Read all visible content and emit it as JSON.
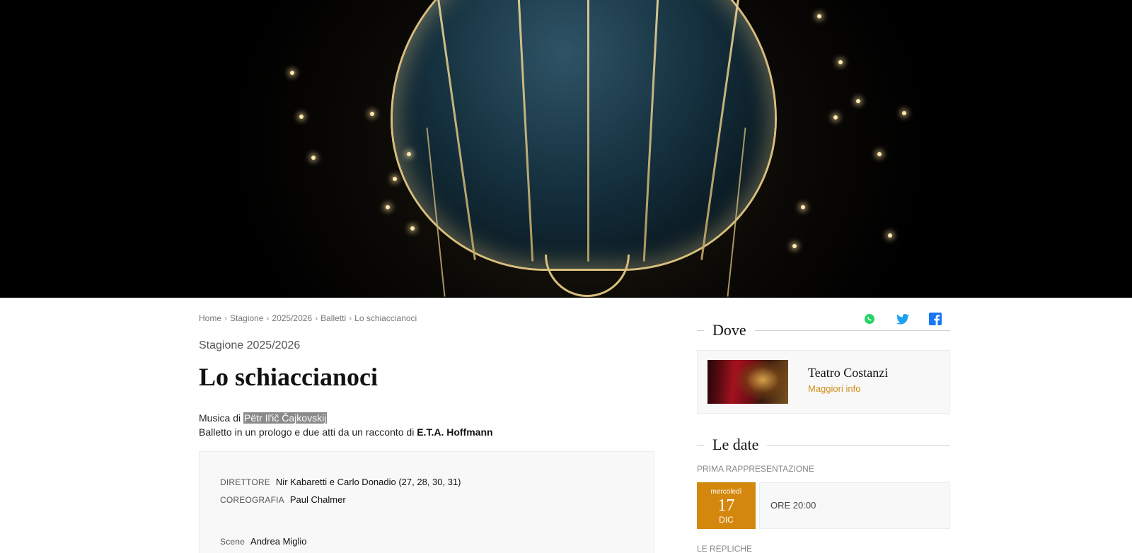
{
  "hero": {
    "image": "hot-air-balloon-lights"
  },
  "breadcrumb": {
    "items": [
      "Home",
      "Stagione",
      "2025/2026",
      "Balletti",
      "Lo schiaccianoci"
    ],
    "separator": "›"
  },
  "event": {
    "season": "Stagione 2025/2026",
    "title": "Lo schiaccianoci",
    "musica_prefix": "Musica di ",
    "composer": "Pëtr Il'ič Čajkovskij",
    "balletto_prefix": "Balletto in un prologo e due atti da un racconto di ",
    "author": "E.T.A. Hoffmann"
  },
  "credits": [
    {
      "role": "DIRETTORE",
      "name": "Nir Kabaretti e Carlo Donadio (27, 28, 30, 31)"
    },
    {
      "role": "COREOGRAFIA",
      "name": "Paul Chalmer"
    },
    {
      "role": "Scene",
      "name": "Andrea Miglio"
    }
  ],
  "social": {
    "icons": [
      "whatsapp-icon",
      "twitter-icon",
      "facebook-icon"
    ],
    "colors": {
      "whatsapp": "#25D366",
      "twitter": "#1DA1F2",
      "facebook": "#1877F2"
    }
  },
  "dove": {
    "heading": "Dove",
    "venue_name": "Teatro Costanzi",
    "more_link": "Maggiori info"
  },
  "date": {
    "heading": "Le date",
    "prima_label": "PRIMA RAPPRESENTAZIONE",
    "weekday": "mercoledì",
    "day": "17",
    "month": "DIC",
    "time": "ORE 20:00",
    "repliche_label": "LE REPLICHE"
  },
  "colors": {
    "accent": "#d4870d",
    "link": "#d08e1c"
  }
}
